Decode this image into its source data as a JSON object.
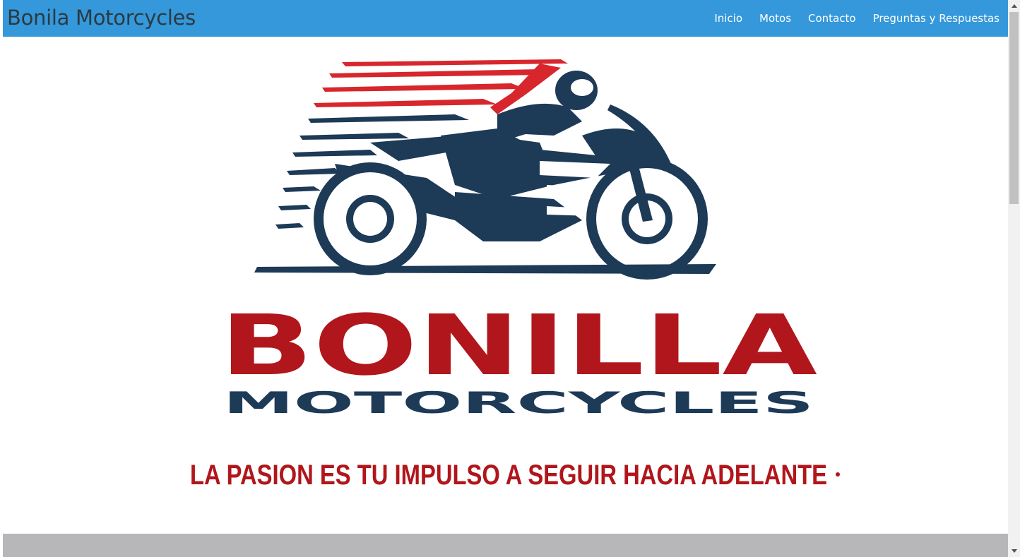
{
  "navbar": {
    "brand": "Bonila Motorcycles",
    "links": [
      "Inicio",
      "Motos",
      "Contacto",
      "Preguntas y Respuestas"
    ],
    "background": "#3498db",
    "brand_color": "#2b3a42",
    "link_color": "#ffffff"
  },
  "hero": {
    "logo": {
      "icon": "motorcycle-rider-logo",
      "wordmark": "BONILLA",
      "subtitle": "MOTORCYCLES",
      "tagline": "LA  PASION  ES TU IMPULSO A SEGUIR  HACIA ADELANTE",
      "wordmark_color": "#b0161b",
      "subtitle_color": "#1d3a57",
      "tagline_color": "#b0161b"
    }
  },
  "footer_band": {
    "color": "#b7b7b9"
  }
}
